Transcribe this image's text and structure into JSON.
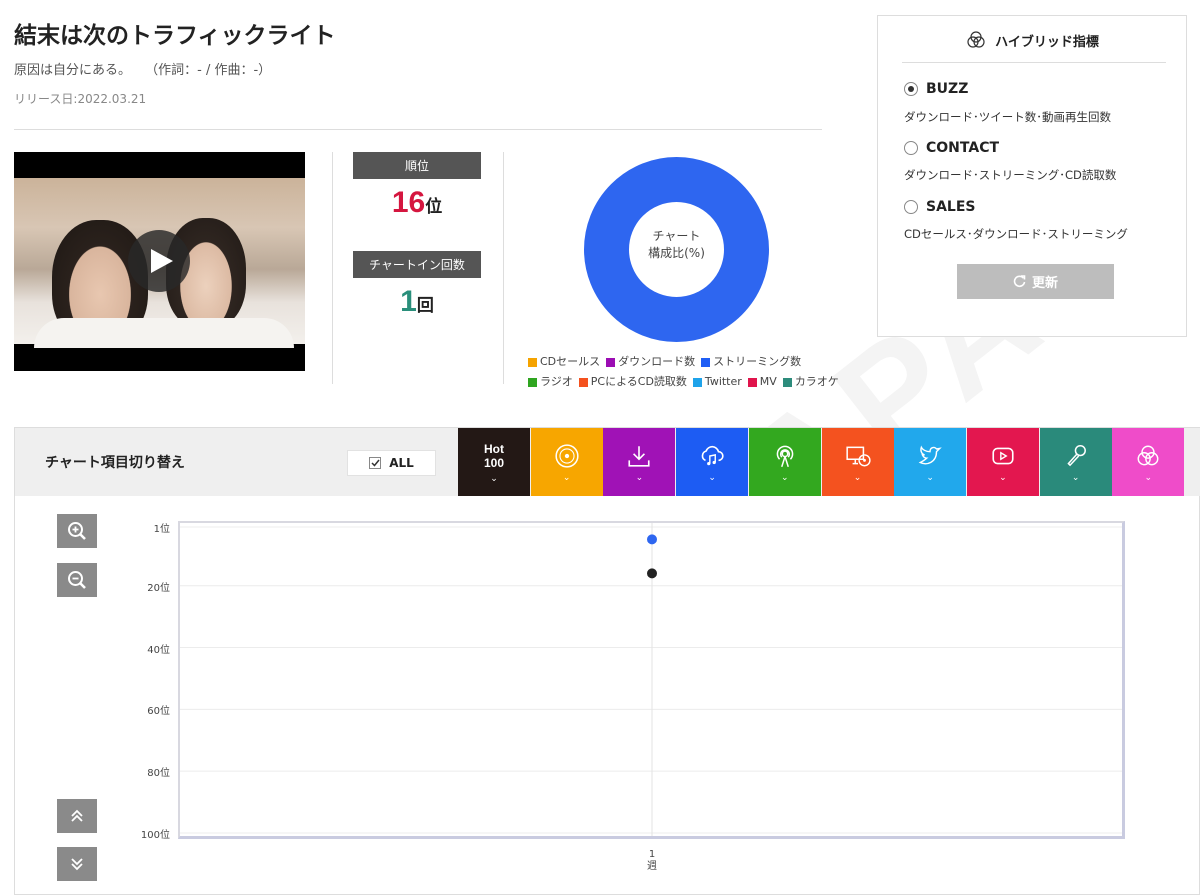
{
  "song": {
    "title": "結末は次のトラフィックライト",
    "artist": "原因は自分にある。",
    "credits": "（作詞：- / 作曲：-）",
    "release": "リリース日:2022.03.21"
  },
  "video": {
    "play_icon": "play-icon"
  },
  "stats": {
    "rank_label": "順位",
    "rank_value": "16",
    "rank_unit": "位",
    "chartin_label": "チャートイン回数",
    "chartin_value": "1",
    "chartin_unit": "回"
  },
  "composition": {
    "center_line1": "チャート",
    "center_line2": "構成比(%)",
    "ring_color": "#2e66f0",
    "legend": [
      {
        "label": "CDセールス",
        "color": "#f5a300"
      },
      {
        "label": "ダウンロード数",
        "color": "#9b0db3"
      },
      {
        "label": "ストリーミング数",
        "color": "#1f5ef5"
      },
      {
        "label": "ラジオ",
        "color": "#2fa520"
      },
      {
        "label": "PCによるCD読取数",
        "color": "#f4511e"
      },
      {
        "label": "Twitter",
        "color": "#1fa3ea"
      },
      {
        "label": "MV",
        "color": "#e0144c"
      },
      {
        "label": "カラオケ",
        "color": "#2d8c7c"
      }
    ]
  },
  "hybrid": {
    "title": "ハイブリッド指標",
    "options": [
      {
        "label": "BUZZ",
        "desc": "ダウンロード･ツイート数･動画再生回数",
        "selected": true
      },
      {
        "label": "CONTACT",
        "desc": "ダウンロード･ストリーミング･CD読取数",
        "selected": false
      },
      {
        "label": "SALES",
        "desc": "CDセールス･ダウンロード･ストリーミング",
        "selected": false
      }
    ],
    "refresh_label": "更新"
  },
  "chart_switch": {
    "title": "チャート項目切り替え",
    "all_label": "ALL",
    "hot_line1": "Hot",
    "hot_line2": "100",
    "tabs": [
      {
        "name": "hot100",
        "color": "#231815",
        "icon": "hot100-icon"
      },
      {
        "name": "cd-sales",
        "color": "#f7a600",
        "icon": "cd-icon"
      },
      {
        "name": "download",
        "color": "#a012b6",
        "icon": "download-icon"
      },
      {
        "name": "streaming",
        "color": "#1d5cf3",
        "icon": "cloud-music-icon"
      },
      {
        "name": "radio",
        "color": "#33a81f",
        "icon": "radio-icon"
      },
      {
        "name": "pc-cd-read",
        "color": "#f4521f",
        "icon": "monitor-cd-icon"
      },
      {
        "name": "twitter",
        "color": "#21a8ec",
        "icon": "twitter-icon"
      },
      {
        "name": "mv",
        "color": "#e3174f",
        "icon": "youtube-icon"
      },
      {
        "name": "karaoke",
        "color": "#2a8a7b",
        "icon": "microphone-icon"
      },
      {
        "name": "hybrid",
        "color": "#ef4cc9",
        "icon": "hybrid-icon"
      }
    ]
  },
  "chart_data": {
    "type": "scatter",
    "x_categories": [
      "1\n週"
    ],
    "y_ticks": [
      "1位",
      "20位",
      "40位",
      "60位",
      "80位",
      "100位"
    ],
    "ylim": [
      1,
      100
    ],
    "y_inverted": true,
    "series": [
      {
        "color": "#2e66f0",
        "points": [
          {
            "x": "1",
            "y": 5
          }
        ]
      },
      {
        "color": "#222222",
        "points": [
          {
            "x": "1",
            "y": 16
          }
        ]
      }
    ]
  }
}
